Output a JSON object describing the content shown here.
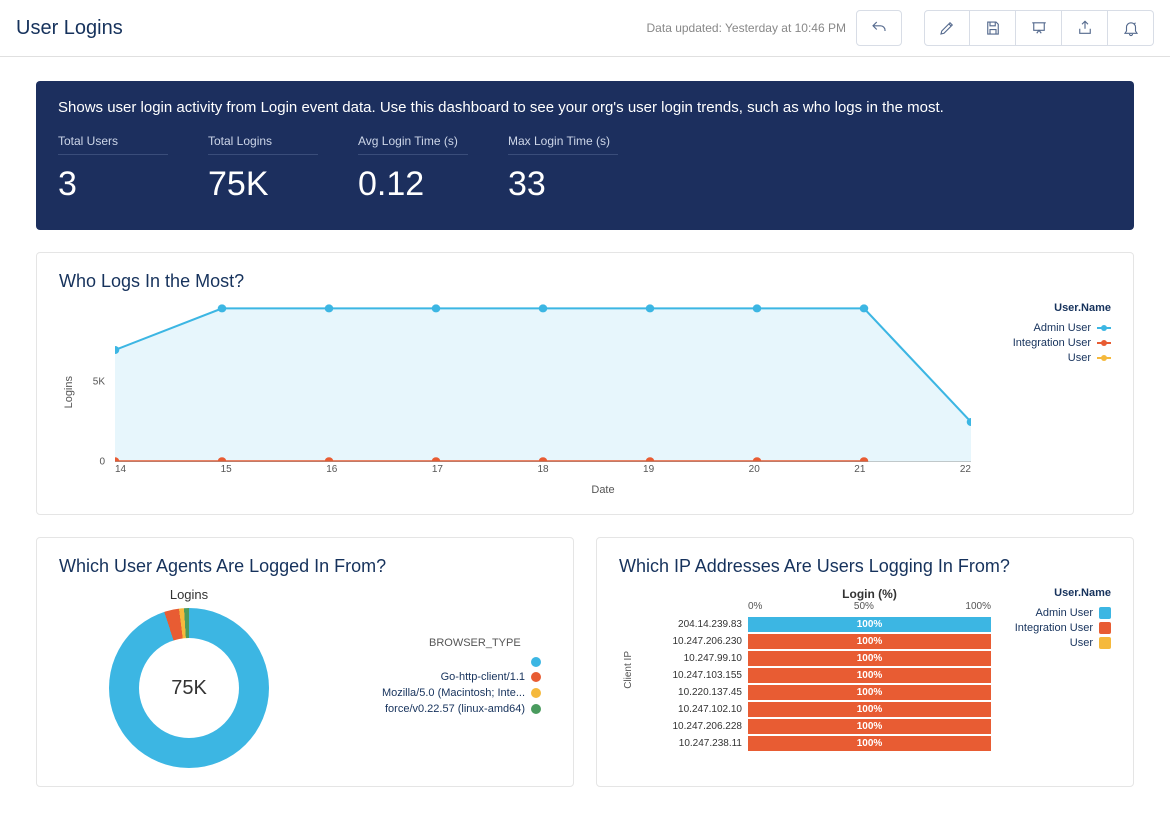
{
  "header": {
    "title": "User Logins",
    "updated": "Data updated: Yesterday at 10:46 PM"
  },
  "banner": {
    "description": "Shows user login activity from Login event data. Use this dashboard to see your org's user login trends, such as who logs in the most.",
    "stats": [
      {
        "label": "Total Users",
        "value": "3"
      },
      {
        "label": "Total Logins",
        "value": "75K"
      },
      {
        "label": "Avg Login Time (s)",
        "value": "0.12"
      },
      {
        "label": "Max Login Time (s)",
        "value": "33"
      }
    ]
  },
  "line_panel": {
    "title": "Who Logs In the Most?",
    "ylabel": "Logins",
    "xlabel": "Date",
    "legend_title": "User.Name"
  },
  "agents_panel": {
    "title": "Which User Agents Are Logged In From?",
    "center_label": "75K",
    "chart_title": "Logins",
    "legend_title": "BROWSER_TYPE"
  },
  "ip_panel": {
    "title": "Which IP Addresses Are Users Logging In From?",
    "header": "Login (%)",
    "legend_title": "User.Name",
    "ylabel": "Client IP",
    "scale": [
      "0%",
      "50%",
      "100%"
    ]
  },
  "colors": {
    "admin": "#3cb6e3",
    "integration": "#e85c33",
    "user": "#f5b93c",
    "mozilla": "#f5b93c",
    "force": "#4a9b5e"
  },
  "chart_data": [
    {
      "type": "line",
      "title": "Who Logs In the Most?",
      "xlabel": "Date",
      "ylabel": "Logins",
      "ylim": [
        0,
        10000
      ],
      "yticks": [
        0,
        5000
      ],
      "categories": [
        14,
        15,
        16,
        17,
        18,
        19,
        20,
        21,
        22
      ],
      "series": [
        {
          "name": "Admin User",
          "color": "#3cb6e3",
          "values": [
            7000,
            9600,
            9600,
            9600,
            9600,
            9600,
            9600,
            9600,
            2500
          ]
        },
        {
          "name": "Integration User",
          "color": "#e85c33",
          "values": [
            50,
            50,
            50,
            50,
            50,
            50,
            50,
            50,
            null
          ]
        },
        {
          "name": "User",
          "color": "#f5b93c",
          "values": [
            null,
            null,
            null,
            null,
            null,
            null,
            null,
            null,
            null
          ]
        }
      ],
      "legend_title": "User.Name"
    },
    {
      "type": "pie",
      "title": "Logins",
      "total_label": "75K",
      "legend_title": "BROWSER_TYPE",
      "slices": [
        {
          "name": "",
          "color": "#3cb6e3",
          "value": 95
        },
        {
          "name": "Go-http-client/1.1",
          "color": "#e85c33",
          "value": 3
        },
        {
          "name": "Mozilla/5.0 (Macintosh; Inte...",
          "color": "#f5b93c",
          "value": 1
        },
        {
          "name": "force/v0.22.57 (linux-amd64)",
          "color": "#4a9b5e",
          "value": 1
        }
      ]
    },
    {
      "type": "bar",
      "orientation": "horizontal",
      "title": "Login (%)",
      "xlim": [
        0,
        100
      ],
      "ylabel": "Client IP",
      "legend_title": "User.Name",
      "legend": [
        "Admin User",
        "Integration User",
        "User"
      ],
      "categories": [
        "204.14.239.83",
        "10.247.206.230",
        "10.247.99.10",
        "10.247.103.155",
        "10.220.137.45",
        "10.247.102.10",
        "10.247.206.228",
        "10.247.238.11"
      ],
      "values": [
        100,
        100,
        100,
        100,
        100,
        100,
        100,
        100
      ],
      "series_for_category": [
        "Admin User",
        "Integration User",
        "Integration User",
        "Integration User",
        "Integration User",
        "Integration User",
        "Integration User",
        "Integration User"
      ]
    }
  ]
}
